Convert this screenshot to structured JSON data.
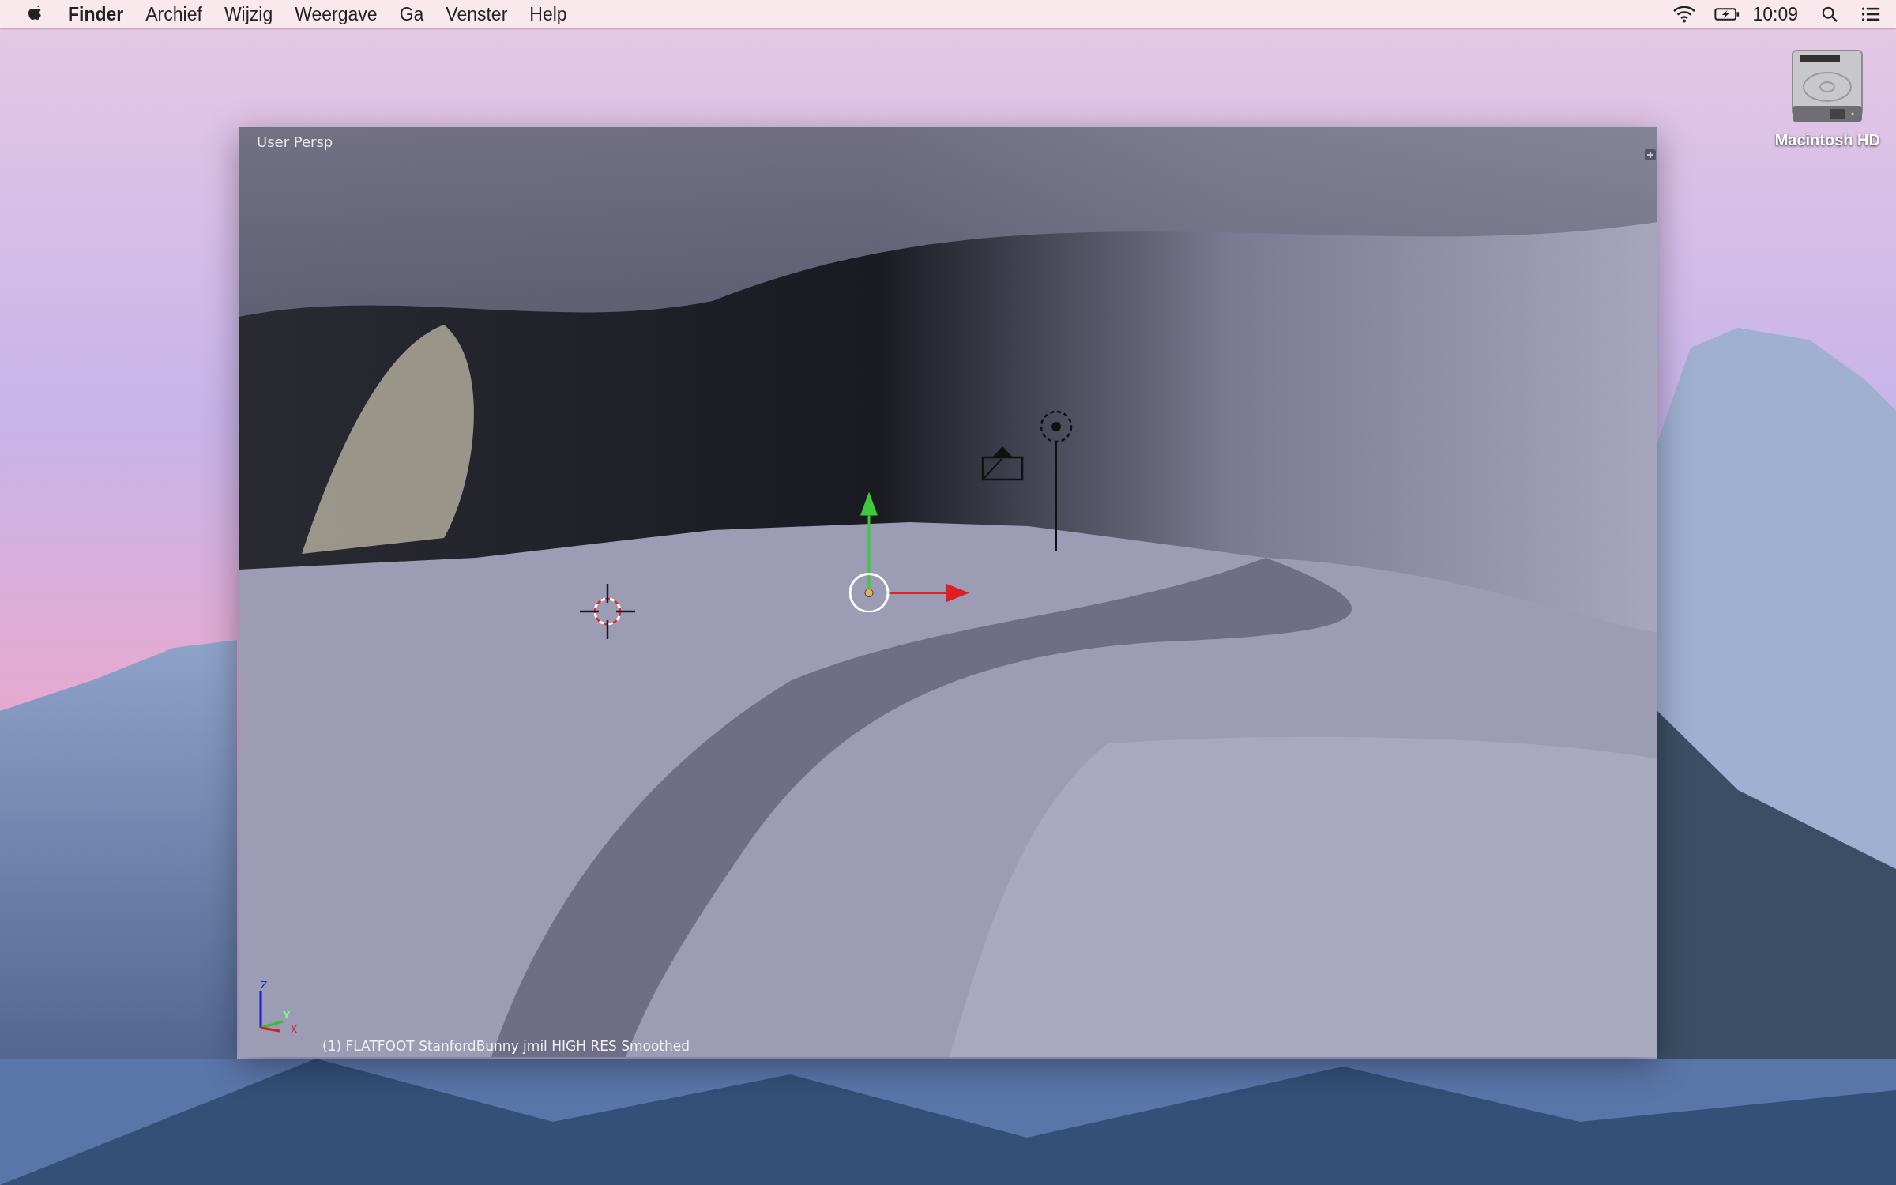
{
  "menu_bar": {
    "app_name": "Finder",
    "menus": [
      "Archief",
      "Wijzig",
      "Weergave",
      "Ga",
      "Venster",
      "Help"
    ],
    "clock": "10:09"
  },
  "viewport": {
    "view_label": "User Persp",
    "axis_labels": [
      "Z",
      "Y",
      "X"
    ],
    "object_label": "(1) FLATFOOT StanfordBunny jmil HIGH RES Smoothed"
  },
  "desktop_icons": [
    {
      "label": "Macintosh HD"
    }
  ]
}
